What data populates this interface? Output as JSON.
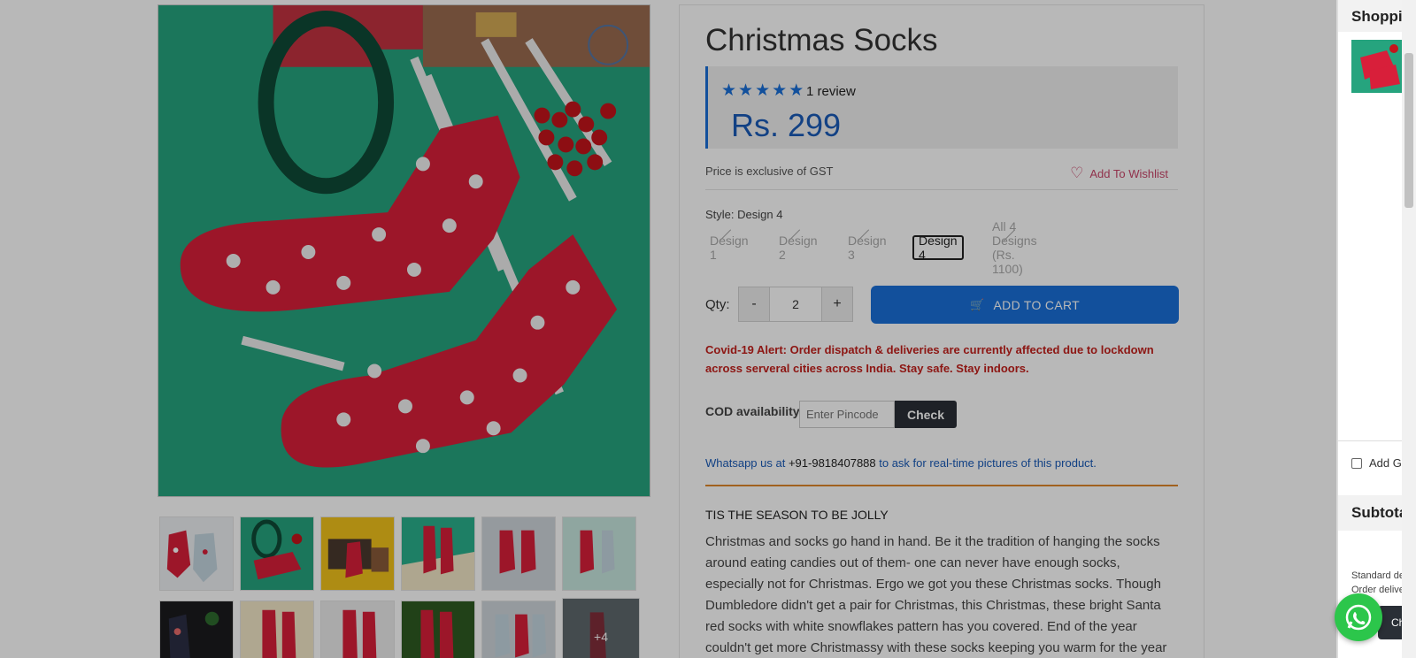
{
  "product": {
    "title": "Christmas Socks",
    "rating_stars": 5,
    "review_count_label": "1 review",
    "price": "Rs. 299",
    "gst_note": "Price is exclusive of GST",
    "wishlist_label": "Add To Wishlist",
    "style_label": "Style: Design 4",
    "style_options": [
      {
        "label": "Design 1",
        "state": "disabled"
      },
      {
        "label": "Design 2",
        "state": "disabled"
      },
      {
        "label": "Design 3",
        "state": "disabled"
      },
      {
        "label": "Design 4",
        "state": "selected"
      },
      {
        "label": "All 4 Designs (Rs. 1100)",
        "state": "disabled"
      }
    ],
    "qty_label": "Qty:",
    "qty_minus": "-",
    "qty_value": "2",
    "qty_plus": "+",
    "add_to_cart_label": "ADD TO CART",
    "alert_text": "Covid-19 Alert: Order dispatch & deliveries are currently affected due to lockdown across serveral cities across India. Stay safe. Stay indoors.",
    "cod_label": "COD availability",
    "pincode_placeholder": "Enter Pincode",
    "check_label": "Check",
    "whatsapp_prefix": "Whatsapp us at ",
    "whatsapp_phone": "+91-9818407888",
    "whatsapp_suffix": " to ask for real-time pictures of this product.",
    "description_title": "TIS THE SEASON TO BE JOLLY",
    "description": "Christmas and socks go hand in hand. Be it the tradition of hanging the socks around eating candies out of them- one can never have enough socks, especially not for Christmas. Ergo we got you these Christmas socks. Though Dumbledore didn't get a pair for Christmas, this Christmas, these bright Santa red socks with white snowflakes pattern has you covered. End of the year couldn't get more Christmassy with these socks keeping you warm for the year to come."
  },
  "gallery": {
    "more_label": "+4",
    "thumb_count": 12
  },
  "side_cart": {
    "title": "Shoppin",
    "gift_label": "Add G",
    "subtotal_label": "Subtota",
    "note_line1": "Standard de",
    "note_line2": "Order delive",
    "checkout_label": "Ch"
  },
  "colors": {
    "accent_blue": "#1a6fd8",
    "price_blue": "#1a5bb8",
    "alert_red": "#c4201c",
    "wishlist_pink": "#c9466a",
    "divider_orange": "#e0872a",
    "whatsapp_green": "#2cc64b"
  },
  "icons": [
    "heart-icon",
    "cart-icon",
    "star-icon",
    "whatsapp-icon"
  ]
}
